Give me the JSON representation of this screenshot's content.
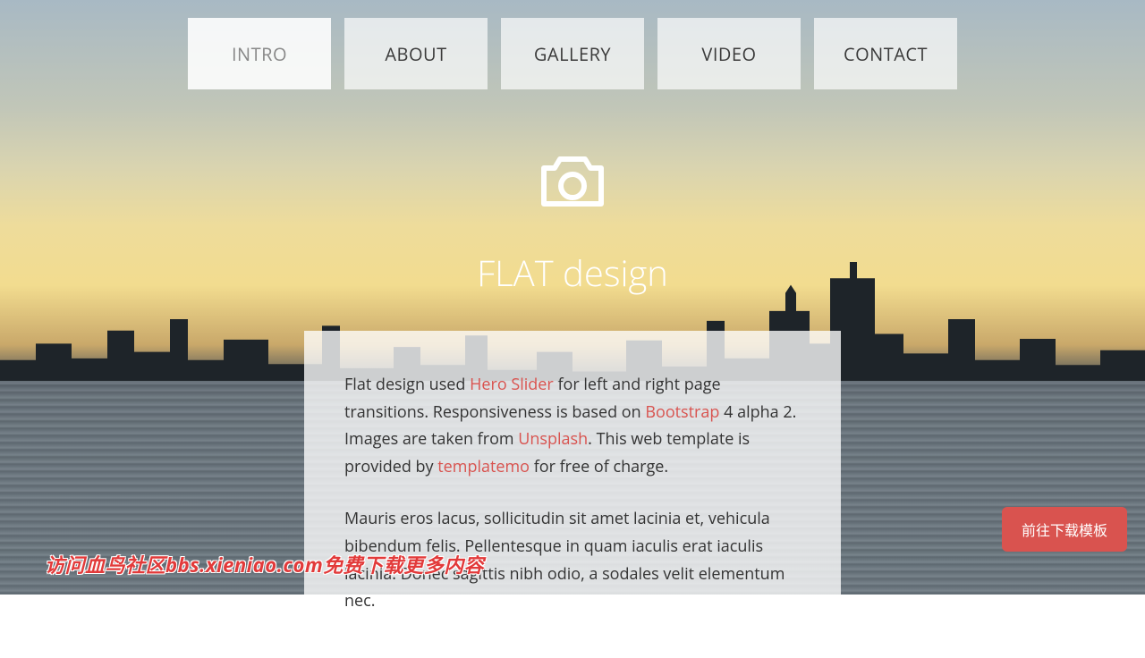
{
  "nav": {
    "items": [
      {
        "label": "INTRO",
        "active": true
      },
      {
        "label": "ABOUT",
        "active": false
      },
      {
        "label": "GALLERY",
        "active": false
      },
      {
        "label": "VIDEO",
        "active": false
      },
      {
        "label": "CONTACT",
        "active": false
      }
    ]
  },
  "hero": {
    "icon": "camera-icon",
    "title": "FLAT design"
  },
  "intro": {
    "p1_seg1": "Flat design used ",
    "p1_link1": "Hero Slider",
    "p1_seg2": " for left and right page transitions. Responsiveness is based on ",
    "p1_link2": "Bootstrap",
    "p1_seg3": " 4 alpha 2. Images are taken from ",
    "p1_link3": "Unsplash",
    "p1_seg4": ". This web template is provided by ",
    "p1_link4": "templatemo",
    "p1_seg5": " for free of charge.",
    "p2": "Mauris eros lacus, sollicitudin sit amet lacinia et, vehicula bibendum felis. Pellentesque in quam iaculis erat iaculis lacinia. Donec sagittis nibh odio, a sodales velit elementum nec."
  },
  "download_button": {
    "label": "前往下载模板"
  },
  "overlay_text": "访问血鸟社区bbs.xieniao.com免费下载更多内容",
  "colors": {
    "accent": "#d9534f",
    "nav_bg": "rgba(255,255,255,0.68)",
    "card_bg": "rgba(255,255,255,0.78)"
  }
}
